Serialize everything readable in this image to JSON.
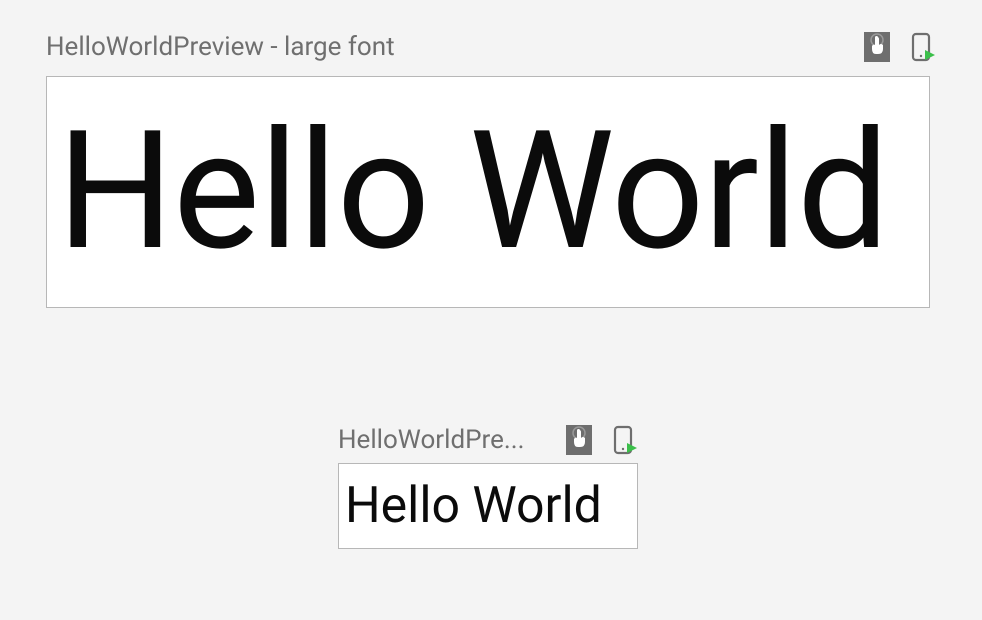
{
  "previews": [
    {
      "title": "HelloWorldPreview - large font",
      "content": "Hello World"
    },
    {
      "title": "HelloWorldPre...",
      "content": "Hello World"
    }
  ]
}
